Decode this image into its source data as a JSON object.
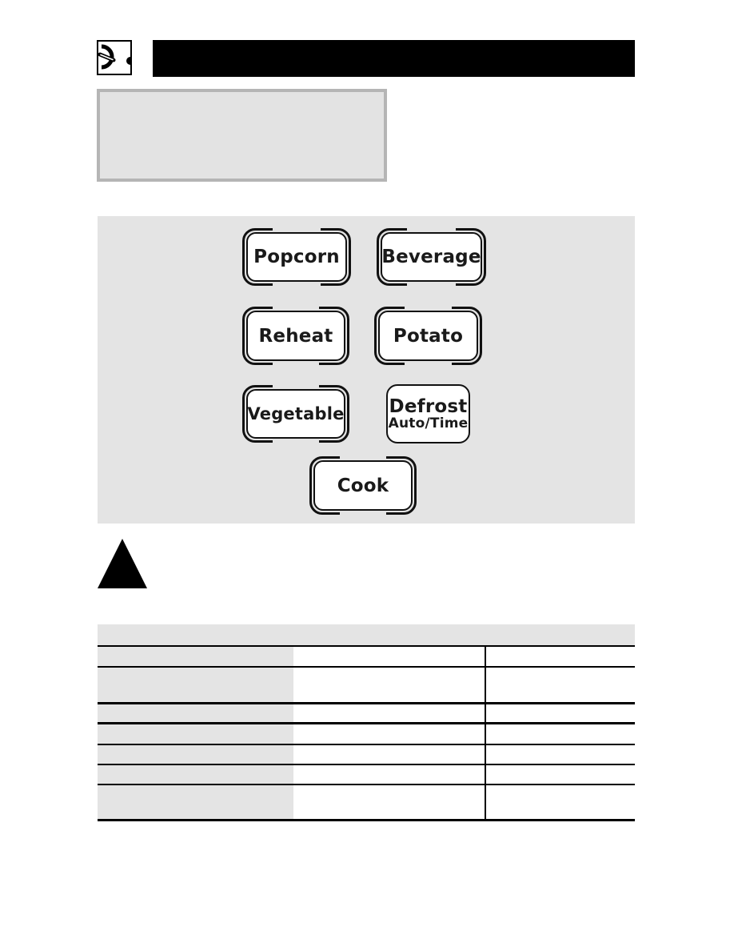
{
  "header": {
    "icon": "dial-knob-icon",
    "title": ""
  },
  "note_box": {
    "text": ""
  },
  "control_panel": {
    "buttons": [
      {
        "id": "popcorn",
        "label": "Popcorn"
      },
      {
        "id": "beverage",
        "label": "Beverage"
      },
      {
        "id": "reheat",
        "label": "Reheat"
      },
      {
        "id": "potato",
        "label": "Potato"
      },
      {
        "id": "vegetable",
        "label": "Vegetable"
      },
      {
        "id": "defrost",
        "label": "Defrost",
        "sublabel": "Auto/Time"
      },
      {
        "id": "cook",
        "label": "Cook"
      }
    ]
  },
  "warning": {
    "icon": "warning-triangle-icon",
    "text": ""
  },
  "table": {
    "header": "",
    "rows": [
      [
        "",
        "",
        ""
      ],
      [
        "",
        "",
        ""
      ],
      [
        "",
        "",
        ""
      ],
      [
        "",
        "",
        ""
      ],
      [
        "",
        "",
        ""
      ],
      [
        "",
        "",
        ""
      ],
      [
        "",
        "",
        ""
      ]
    ]
  },
  "colors": {
    "panel_gray": "#e4e4e4",
    "note_border": "#b5b5b5",
    "ink": "#000000"
  }
}
